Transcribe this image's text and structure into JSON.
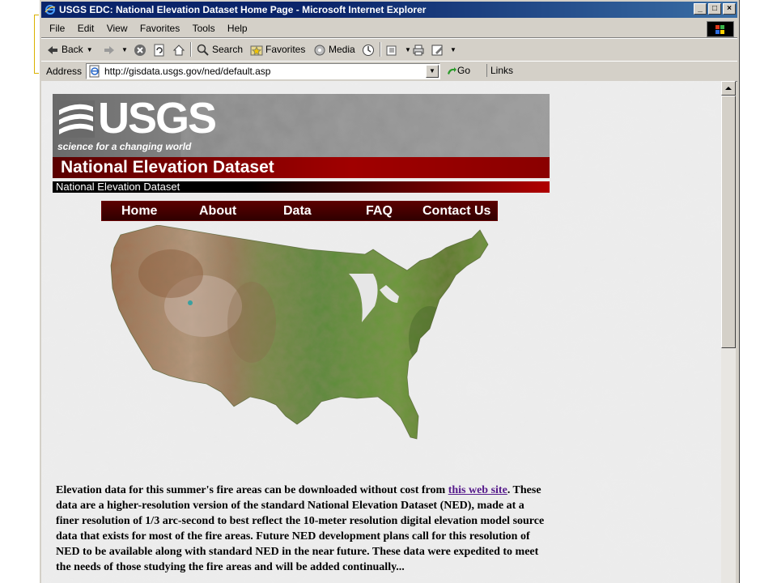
{
  "window": {
    "title": "USGS EDC: National Elevation Dataset Home Page - Microsoft Internet Explorer",
    "buttons": [
      "_",
      "□",
      "×"
    ]
  },
  "menu": [
    "File",
    "Edit",
    "View",
    "Favorites",
    "Tools",
    "Help"
  ],
  "toolbar": {
    "back": "Back",
    "search": "Search",
    "favorites": "Favorites",
    "media": "Media"
  },
  "address": {
    "label": "Address",
    "url": "http://gisdata.usgs.gov/ned/default.asp",
    "go": "Go",
    "links": "Links"
  },
  "page": {
    "logo": "USGS",
    "tagline": "science for a changing world",
    "banner_title": "National Elevation Dataset",
    "banner_subtitle": "National Elevation Dataset",
    "nav": [
      "Home",
      "About",
      "Data",
      "FAQ",
      "Contact Us"
    ],
    "para_1": "Elevation data for this summer's fire areas can be downloaded without cost from ",
    "link_text": "this web site",
    "para_2": ". These data are a higher-resolution version of the standard National Elevation Dataset (NED), made at a finer resolution of 1/3 arc-second to best reflect the 10-meter resolution digital elevation model source data that exists for most of the fire areas. Future NED development plans call for this resolution of NED to be available along with standard NED in the near future. These data were expedited to meet the needs of those studying the fire areas and will be added continually..."
  },
  "colors": {
    "title_bar": "#0a246a",
    "banner_red": "#a00000",
    "link": "#551a8b",
    "slide_accent": "#d9b100"
  }
}
